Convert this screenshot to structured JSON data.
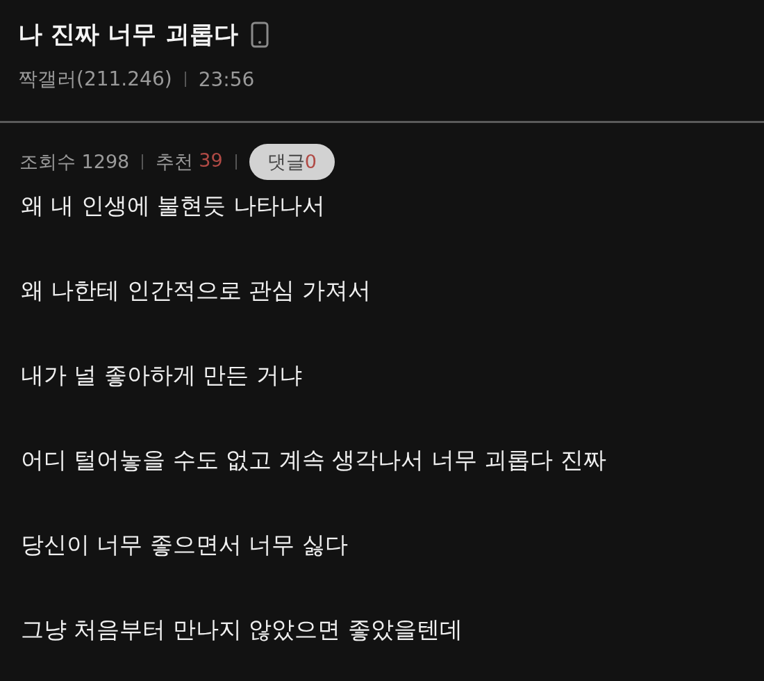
{
  "post": {
    "title": "나 진짜 너무 괴롭다",
    "author": "짝갤러(211.246)",
    "time": "23:56"
  },
  "stats": {
    "views_label": "조회수",
    "views": "1298",
    "recommend_label": "추천",
    "recommend": "39",
    "comments_label": "댓글",
    "comments": "0"
  },
  "body": [
    "왜 내 인생에 불현듯 나타나서",
    "왜 나한테 인간적으로 관심 가져서",
    "내가 널 좋아하게 만든 거냐",
    "어디 털어놓을 수도 없고 계속 생각나서 너무 괴롭다 진짜",
    "당신이 너무 좋으면서 너무 싫다",
    "그냥 처음부터 만나지 않았으면 좋았을텐데"
  ]
}
